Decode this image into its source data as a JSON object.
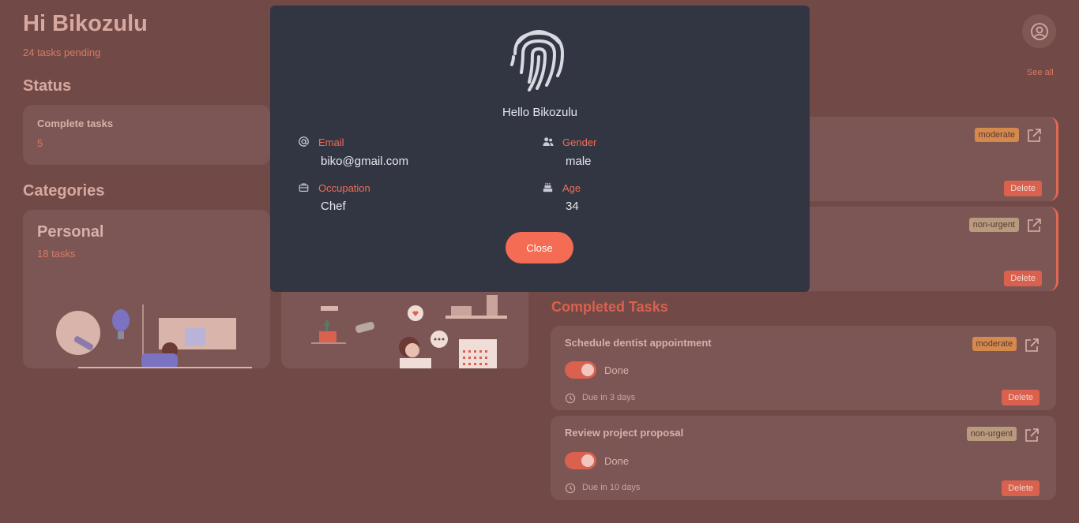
{
  "header": {
    "greeting": "Hi Bikozulu",
    "pending": "24 tasks pending"
  },
  "status": {
    "heading": "Status",
    "complete_label": "Complete tasks",
    "complete_value": "5"
  },
  "categories": {
    "heading": "Categories",
    "items": [
      {
        "name": "Personal",
        "count": "18 tasks"
      }
    ]
  },
  "see_all": "See all",
  "pending_tasks": [
    {
      "priority": "moderate",
      "delete": "Delete"
    },
    {
      "priority": "non-urgent",
      "delete": "Delete"
    }
  ],
  "completed": {
    "heading": "Completed Tasks",
    "tasks": [
      {
        "title": "Schedule dentist appointment",
        "priority": "moderate",
        "status": "Done",
        "due": "Due in 3 days",
        "delete": "Delete"
      },
      {
        "title": "Review project proposal",
        "priority": "non-urgent",
        "status": "Done",
        "due": "Due in 10 days",
        "delete": "Delete"
      }
    ]
  },
  "modal": {
    "hello": "Hello Bikozulu",
    "email_label": "Email",
    "email_value": "biko@gmail.com",
    "gender_label": "Gender",
    "gender_value": "male",
    "occupation_label": "Occupation",
    "occupation_value": "Chef",
    "age_label": "Age",
    "age_value": "34",
    "close": "Close"
  },
  "colors": {
    "accent": "#f36c53",
    "modal_bg": "#323643",
    "overlay_bg": "#714a48",
    "moderate": "#d48a4d",
    "non_urgent": "#b89a7e"
  }
}
